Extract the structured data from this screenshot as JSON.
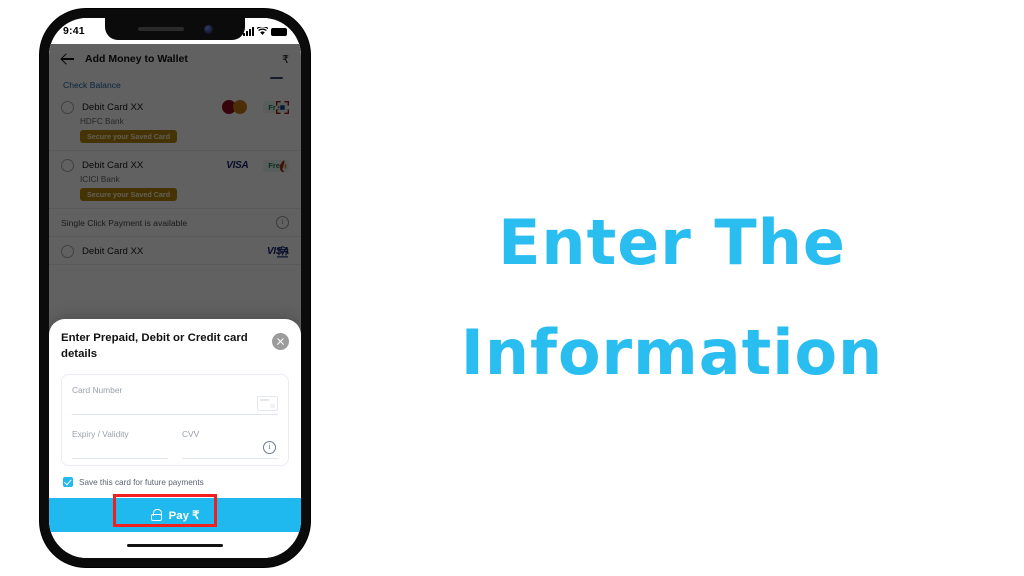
{
  "caption": {
    "line1": "Enter The",
    "line2": "Information",
    "color": "#29bdf0"
  },
  "phone": {
    "status_bar": {
      "time": "9:41",
      "signal_icon": "cellular-bars-icon",
      "wifi_icon": "wifi-icon",
      "battery_icon": "battery-icon"
    },
    "home_indicator": "home-indicator"
  },
  "app": {
    "header": {
      "back_icon": "back-arrow-icon",
      "title": "Add Money to Wallet",
      "currency": "₹"
    },
    "check_balance": "Check Balance",
    "cards": [
      {
        "name": "Debit Card XX",
        "bank": "HDFC Bank",
        "brand": "mastercard",
        "badge": "Free",
        "secure_badge": "Secure your Saved Card",
        "bank_icon": "hdfc-logo-icon"
      },
      {
        "name": "Debit Card XX",
        "bank": "ICICI Bank",
        "brand": "VISA",
        "badge": "Free",
        "secure_badge": "Secure your Saved Card",
        "bank_icon": "icici-logo-icon"
      }
    ],
    "single_click_note": "Single Click Payment is available",
    "info_icon": "info-circle-icon",
    "third_card": {
      "name": "Debit Card XX",
      "brand": "VISA",
      "bank_icon": "bank-building-icon"
    }
  },
  "sheet": {
    "title": "Enter Prepaid, Debit or Credit card details",
    "close_icon": "close-icon",
    "fields": {
      "card_number_label": "Card Number",
      "card_number_value": "",
      "scan_icon": "scan-card-icon",
      "expiry_label": "Expiry / Validity",
      "expiry_value": "",
      "cvv_label": "CVV",
      "cvv_value": "",
      "cvv_info_icon": "info-circle-icon"
    },
    "save_card": {
      "checked": true,
      "label": "Save this card for future payments"
    },
    "pay_button": {
      "lock_icon": "lock-icon",
      "label": "Pay ₹",
      "background": "#1fb8ef",
      "highlight_color": "#f21f1f"
    }
  }
}
